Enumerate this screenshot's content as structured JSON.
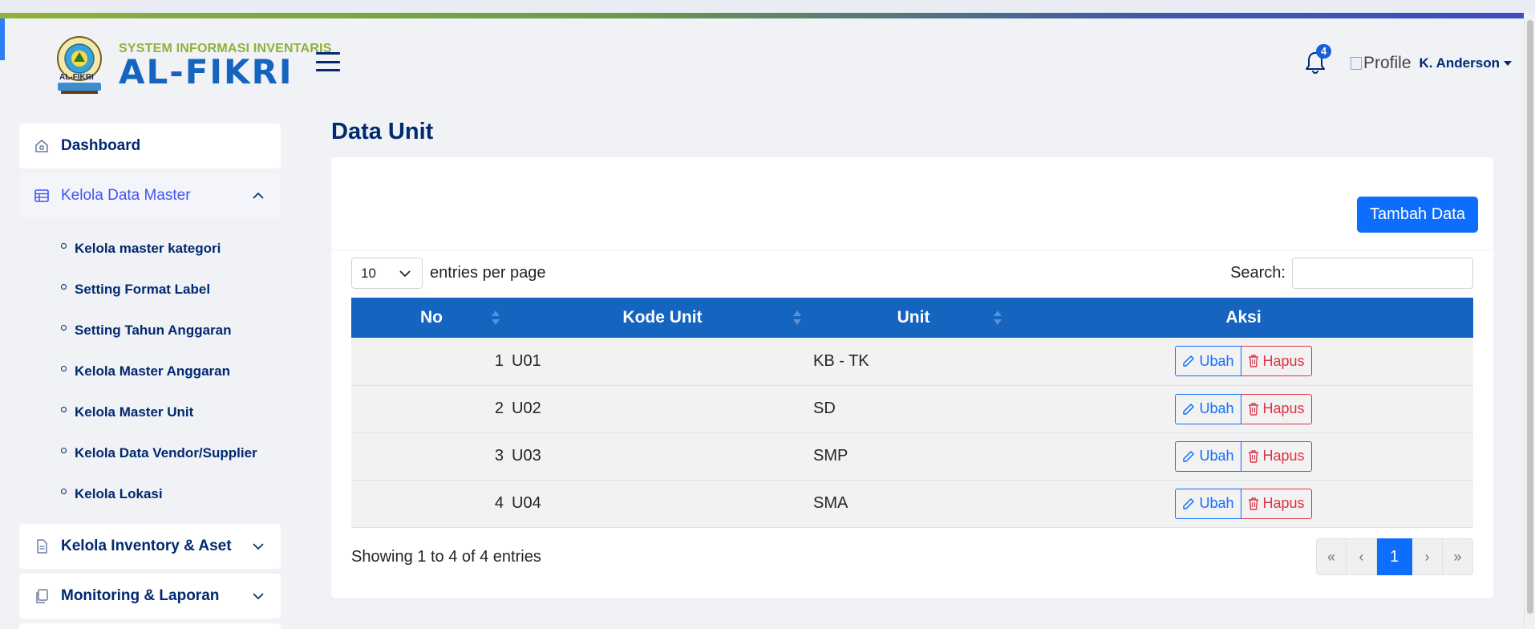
{
  "brand": {
    "subtitle": "SYSTEM INFORMASI INVENTARIS",
    "title": "AL-FIKRI",
    "emblem_text": "AL-FIKRI"
  },
  "header": {
    "notification_count": "4",
    "profile_alt": "Profile",
    "user_name": "K. Anderson"
  },
  "sidebar": {
    "dashboard": "Dashboard",
    "master": {
      "label": "Kelola Data Master",
      "items": [
        "Kelola master kategori",
        "Setting Format Label",
        "Setting Tahun Anggaran",
        "Kelola Master Anggaran",
        "Kelola Master Unit",
        "Kelola Data Vendor/Supplier",
        "Kelola Lokasi"
      ]
    },
    "inventory": "Kelola Inventory & Aset",
    "monitoring": "Monitoring & Laporan"
  },
  "main": {
    "page_title": "Data Unit",
    "add_button": "Tambah Data",
    "entries_value": "10",
    "entries_label": "entries per page",
    "search_label": "Search:",
    "search_value": "",
    "columns": [
      "No",
      "Kode Unit",
      "Unit",
      "Aksi"
    ],
    "rows": [
      {
        "no": "1",
        "kode": "U01",
        "unit": "KB - TK"
      },
      {
        "no": "2",
        "kode": "U02",
        "unit": "SD"
      },
      {
        "no": "3",
        "kode": "U03",
        "unit": "SMP"
      },
      {
        "no": "4",
        "kode": "U04",
        "unit": "SMA"
      }
    ],
    "edit_label": "Ubah",
    "delete_label": "Hapus",
    "showing": "Showing 1 to 4 of 4 entries",
    "pagination": [
      "«",
      "‹",
      "1",
      "›",
      "»"
    ]
  },
  "colors": {
    "primary": "#0d6efd",
    "table_header": "#1565c0",
    "danger": "#dc3545",
    "nav_text": "#012970",
    "active_nav": "#4154f1",
    "brand_green": "#8fb23a"
  }
}
